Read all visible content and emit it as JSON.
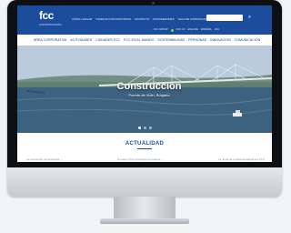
{
  "header": {
    "logo": "fcc",
    "logo_sub": "CONSTRUCCIÓN",
    "top_links": [
      "CÓMO LLEGAR",
      "TRABAJA CON NOSOTROS",
      "CONTACTO",
      "PROVEEDORES",
      "SALA DE COMUNICACIÓN"
    ],
    "search_placeholder": "",
    "util_links": [
      "FCC GROUP",
      "FCC CO",
      "ENGLISH",
      "ESPAÑOL",
      "FCC"
    ]
  },
  "nav": {
    "items": [
      "ÁREA CORPORATIVA",
      "ACTIVIDADES",
      "CIUDADES FCC",
      "FCC EN EL MUNDO",
      "SOSTENIBILIDAD",
      "PERSONAS",
      "INNOVACIÓN",
      "COMUNICACIÓN"
    ]
  },
  "hero": {
    "title": "Construcción",
    "subtitle": "Puente de Vidin, Bulgaria",
    "slide_count": 3,
    "active_slide": 1
  },
  "news": {
    "title": "ACTUALIDAD",
    "snippets": [
      "La exposición de la Muralla ...",
      "El puerto FCC construye la variante ...",
      "La Junta de Andalucía adjudica a FCC"
    ]
  }
}
